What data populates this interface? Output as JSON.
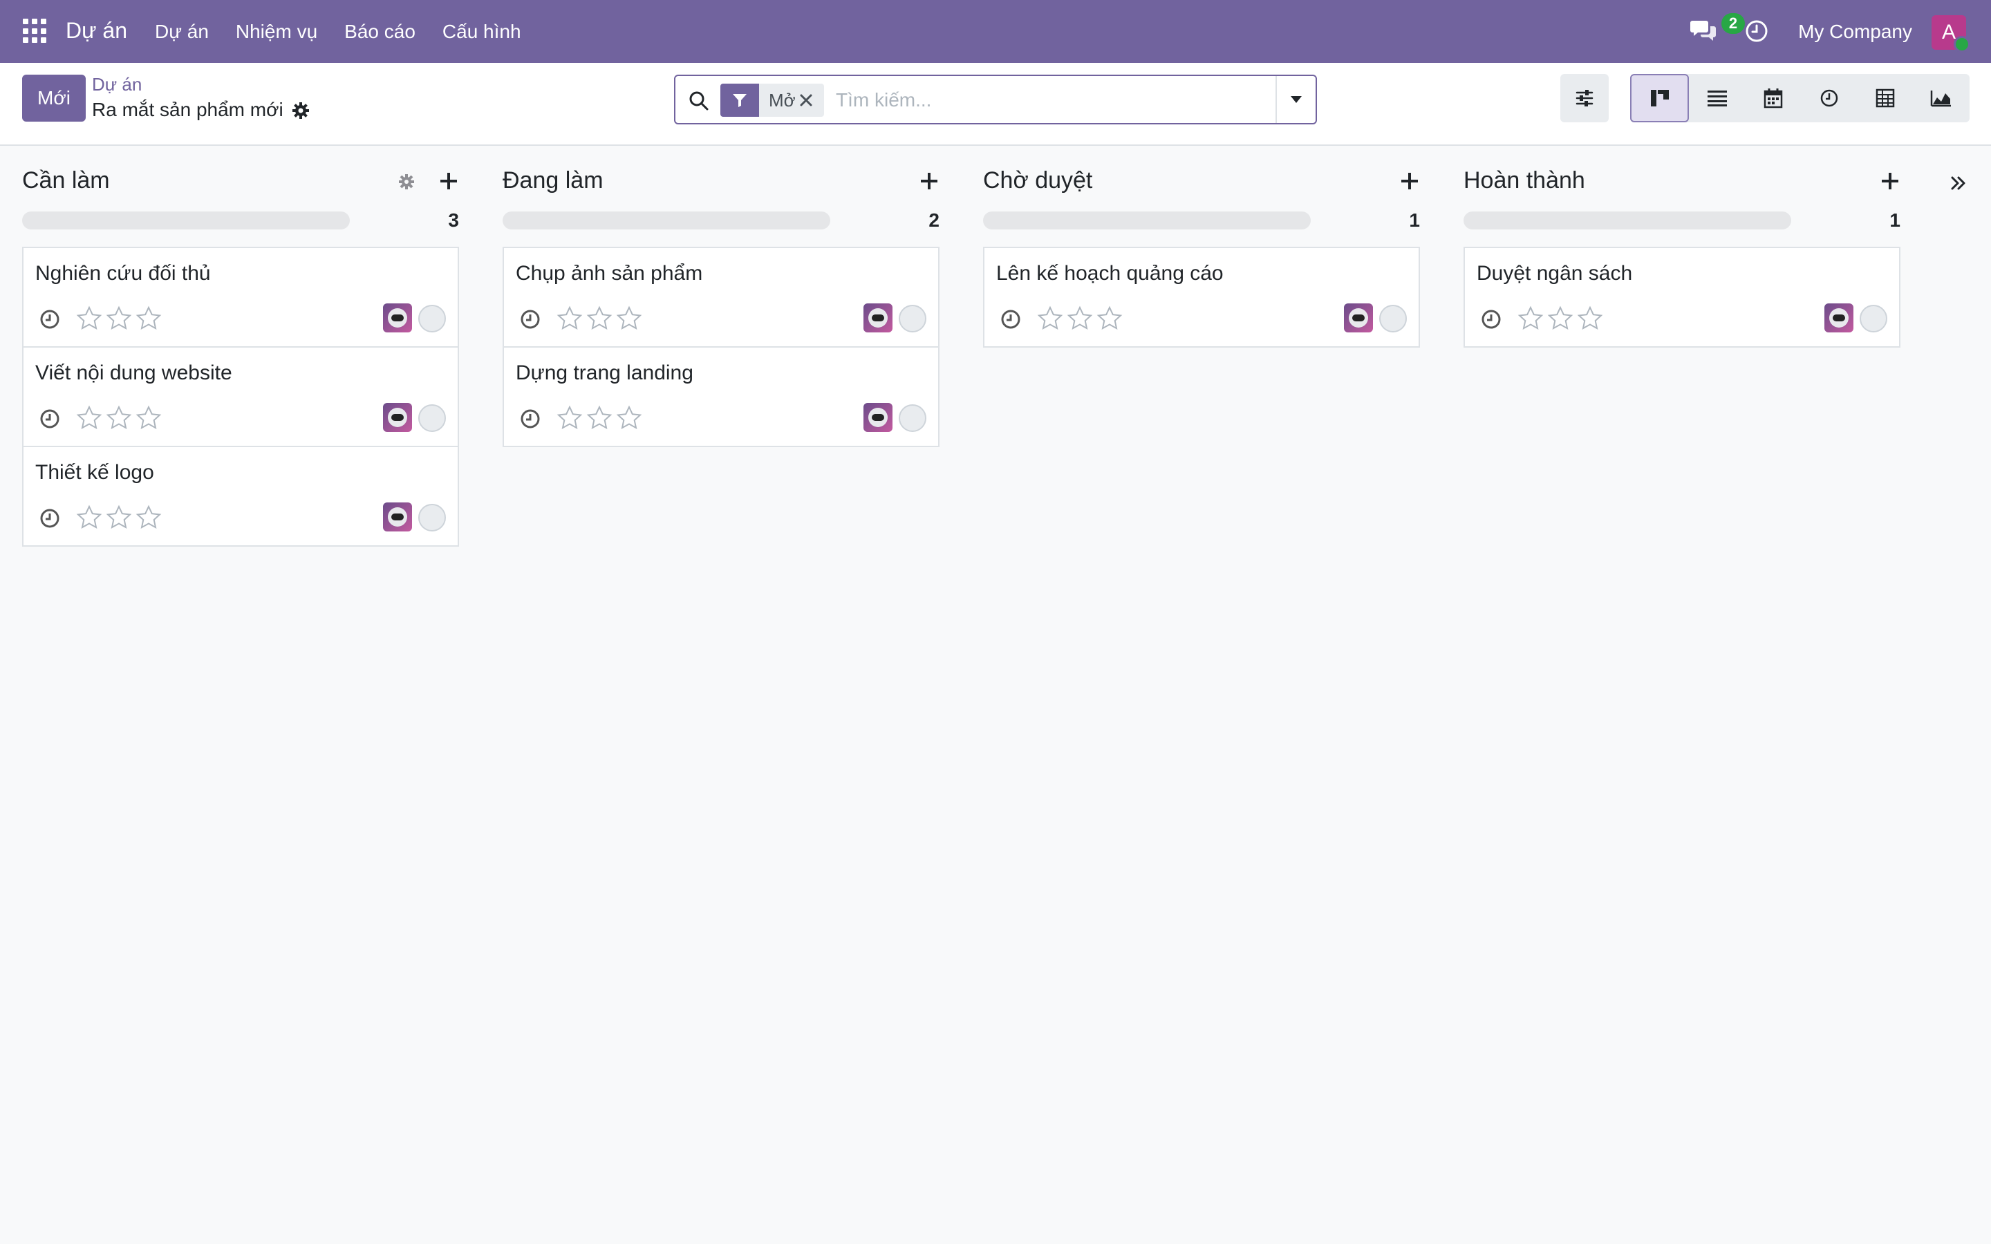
{
  "navbar": {
    "brand": "Dự án",
    "menu": [
      "Dự án",
      "Nhiệm vụ",
      "Báo cáo",
      "Cấu hình"
    ],
    "chat_count": "2",
    "company": "My Company",
    "avatar_letter": "A",
    "background": "#71639e"
  },
  "control_panel": {
    "new_button": "Mới",
    "breadcrumb_parent": "Dự án",
    "breadcrumb_current": "Ra mắt sản phẩm mới",
    "search": {
      "facet_label": "Mở",
      "placeholder": "Tìm kiếm..."
    },
    "views": [
      "kanban",
      "list",
      "calendar",
      "activity",
      "pivot",
      "graph"
    ],
    "active_view": "kanban"
  },
  "kanban": {
    "columns": [
      {
        "title": "Cần làm",
        "count": "3",
        "cards": [
          {
            "title": "Nghiên cứu đối thủ"
          },
          {
            "title": "Viết nội dung website"
          },
          {
            "title": "Thiết kế logo"
          }
        ]
      },
      {
        "title": "Đang làm",
        "count": "2",
        "cards": [
          {
            "title": "Chụp ảnh sản phẩm"
          },
          {
            "title": "Dựng trang landing"
          }
        ]
      },
      {
        "title": "Chờ duyệt",
        "count": "1",
        "cards": [
          {
            "title": "Lên kế hoạch quảng cáo"
          }
        ]
      },
      {
        "title": "Hoàn thành",
        "count": "1",
        "cards": [
          {
            "title": "Duyệt ngân sách"
          }
        ]
      }
    ]
  }
}
